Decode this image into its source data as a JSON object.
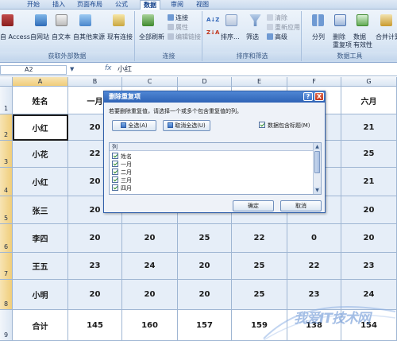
{
  "menu": {
    "tabs": [
      "开始",
      "插入",
      "页面布局",
      "公式",
      "数据",
      "审阅",
      "视图"
    ],
    "active_tab": "数据"
  },
  "ribbon": {
    "get_external_data": {
      "title": "获取外部数据",
      "buttons": [
        "自 Access",
        "自网站",
        "自文本",
        "自其他来源",
        "现有连接"
      ]
    },
    "connections": {
      "title": "连接",
      "refresh_all": "全部刷新",
      "connections": "连接",
      "properties": "属性",
      "edit_links": "编辑链接"
    },
    "sort_filter": {
      "title": "排序和筛选",
      "sort": "排序...",
      "filter": "筛选",
      "clear": "清除",
      "reapply": "重新应用",
      "advanced": "高级"
    },
    "data_tools": {
      "title": "数据工具",
      "split": "分列",
      "remove_duplicates_line1": "删除",
      "remove_duplicates_line2": "重复项",
      "data_validation_line1": "数据",
      "data_validation_line2": "有效性",
      "consolidate": "合并计算"
    }
  },
  "formula_bar": {
    "name_box": "A2",
    "fx": "fx",
    "value": "小红"
  },
  "sheet": {
    "columns": [
      "A",
      "B",
      "C",
      "D",
      "E",
      "F",
      "G"
    ],
    "rows": [
      "1",
      "2",
      "3",
      "4",
      "5",
      "6",
      "7",
      "8",
      "9"
    ],
    "header_row": {
      "name": "姓名",
      "b": "一月",
      "g": "六月"
    },
    "data": [
      {
        "name": "小红",
        "b": "20",
        "c": "",
        "d": "",
        "e": "",
        "f": "",
        "g": "21"
      },
      {
        "name": "小花",
        "b": "22",
        "c": "",
        "d": "",
        "e": "",
        "f": "",
        "g": "25"
      },
      {
        "name": "小红",
        "b": "20",
        "c": "",
        "d": "",
        "e": "",
        "f": "",
        "g": "21"
      },
      {
        "name": "张三",
        "b": "20",
        "c": "",
        "d": "",
        "e": "",
        "f": "",
        "g": "20"
      },
      {
        "name": "李四",
        "b": "20",
        "c": "20",
        "d": "25",
        "e": "22",
        "f": "0",
        "g": "20"
      },
      {
        "name": "王五",
        "b": "23",
        "c": "24",
        "d": "20",
        "e": "25",
        "f": "22",
        "g": "23"
      },
      {
        "name": "小明",
        "b": "20",
        "c": "20",
        "d": "20",
        "e": "25",
        "f": "23",
        "g": "24"
      }
    ],
    "total": {
      "name": "合计",
      "b": "145",
      "c": "160",
      "d": "157",
      "e": "159",
      "f": "138",
      "g": "154"
    }
  },
  "dialog": {
    "title": "删除重复项",
    "help": "?",
    "close": "X",
    "instruction": "若要删除重复值，请选择一个或多个包含重复值的列。",
    "select_all": "全选(A)",
    "unselect_all": "取消全选(U)",
    "has_headers": "数据包含标题(M)",
    "list_header": "列",
    "columns": [
      "姓名",
      "一月",
      "二月",
      "三月",
      "四月"
    ],
    "ok": "确定",
    "cancel": "取消"
  },
  "watermark": {
    "text": "我爱IT技术网"
  },
  "colors": {
    "accent": "#2e63b6",
    "selection": "#e6eef8",
    "header": "#dbe6f3"
  }
}
